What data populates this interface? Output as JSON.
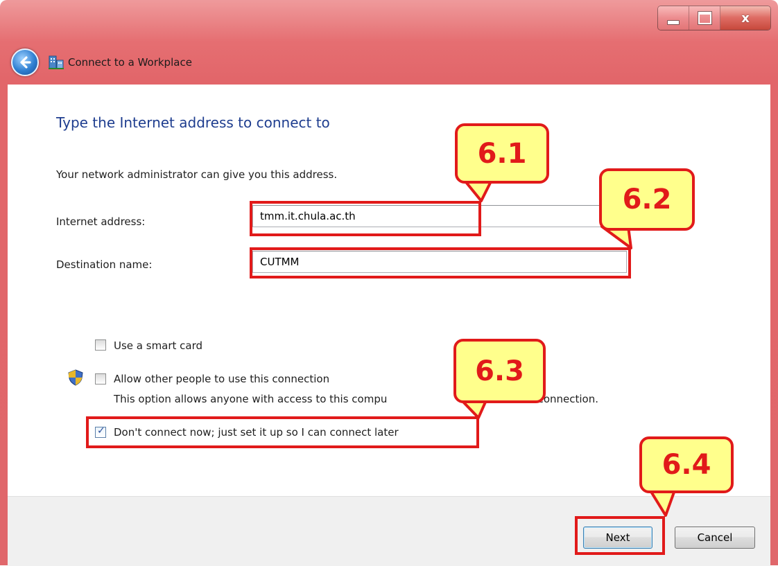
{
  "window": {
    "title": "Connect to a Workplace",
    "caption_buttons": {
      "minimize": "minimize",
      "maximize": "maximize",
      "close": "x"
    }
  },
  "main": {
    "heading": "Type the Internet address to connect to",
    "subtext": "Your network administrator can give you this address.",
    "internet_address_label": "Internet address:",
    "internet_address_value": "tmm.it.chula.ac.th",
    "destination_label": "Destination name:",
    "destination_value": "CUTMM",
    "smart_card_label": "Use a smart card",
    "allow_others_label": "Allow other people to use this connection",
    "allow_others_desc_left": "This option allows anyone with access to this compu",
    "allow_others_desc_right": "s connection.",
    "dont_connect_label": "Don't connect now; just set it up so I can connect later"
  },
  "checkboxes": {
    "smart_card": false,
    "allow_others": false,
    "dont_connect": true
  },
  "buttons": {
    "next": "Next",
    "cancel": "Cancel"
  },
  "callouts": [
    "6.1",
    "6.2",
    "6.3",
    "6.4"
  ],
  "colors": {
    "frame": "#e0676b",
    "highlight": "#e11a1a",
    "callout_fill": "#ffff8c",
    "heading": "#1e3d8f"
  },
  "icons": [
    "back-arrow-icon",
    "workplace-icon",
    "shield-icon",
    "checkmark-icon"
  ]
}
